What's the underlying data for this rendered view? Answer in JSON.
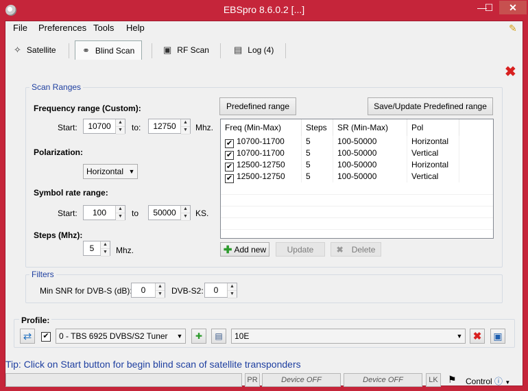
{
  "window": {
    "title": "EBSpro 8.6.0.2 [...]",
    "minimize": "—",
    "maximize": "☐",
    "close": "✕"
  },
  "menu": [
    "File",
    "Preferences",
    "Tools",
    "Help"
  ],
  "tabs": [
    {
      "label": "Satellite",
      "icon": "satellite-icon"
    },
    {
      "label": "Blind Scan",
      "icon": "binoculars-icon",
      "active": true
    },
    {
      "label": "RF Scan",
      "icon": "monitor-icon"
    },
    {
      "label": "Log (4)",
      "icon": "document-icon"
    }
  ],
  "scan_ranges": {
    "legend": "Scan Ranges",
    "freq_label": "Frequency range (Custom):",
    "start_label": "Start:",
    "start_freq": "10700",
    "to_label": "to:",
    "end_freq": "12750",
    "freq_unit": "Mhz.",
    "pol_label": "Polarization:",
    "polarization": "Horizontal",
    "sr_label": "Symbol rate range:",
    "sr_start_label": "Start:",
    "sr_start": "100",
    "sr_to_label": "to",
    "sr_end": "50000",
    "sr_unit": "KS.",
    "steps_label": "Steps (Mhz):",
    "steps": "5",
    "steps_unit": "Mhz."
  },
  "predefined": {
    "predefined_button": "Predefined range",
    "save_button": "Save/Update Predefined range",
    "columns": [
      "Freq (Min-Max)",
      "Steps",
      "SR (Min-Max)",
      "Pol"
    ],
    "rows": [
      {
        "checked": true,
        "freq": "10700-11700",
        "steps": "5",
        "sr": "100-50000",
        "pol": "Horizontal"
      },
      {
        "checked": true,
        "freq": "10700-11700",
        "steps": "5",
        "sr": "100-50000",
        "pol": "Vertical"
      },
      {
        "checked": true,
        "freq": "12500-12750",
        "steps": "5",
        "sr": "100-50000",
        "pol": "Horizontal"
      },
      {
        "checked": true,
        "freq": "12500-12750",
        "steps": "5",
        "sr": "100-50000",
        "pol": "Vertical"
      }
    ],
    "add_button": "Add new",
    "update_button": "Update",
    "delete_button": "Delete"
  },
  "filters": {
    "legend": "Filters",
    "snr_label": "Min SNR for DVB-S (dB):",
    "snr_value": "0",
    "s2_label": "DVB-S2:",
    "s2_value": "0"
  },
  "profile": {
    "label": "Profile:",
    "tuner": "0 - TBS 6925 DVBS/S2 Tuner",
    "satellite": "10E"
  },
  "status": {
    "tip": "Tip: Click on Start button for begin blind scan of satellite transponders",
    "pr": "PR",
    "device1": "Device OFF",
    "device2": "Device OFF",
    "lk": "LK",
    "control": "Control"
  },
  "colors": {
    "titlebar": "#c5253a",
    "accent_blue": "#1e3fa0",
    "delete_red": "#d8201f"
  }
}
